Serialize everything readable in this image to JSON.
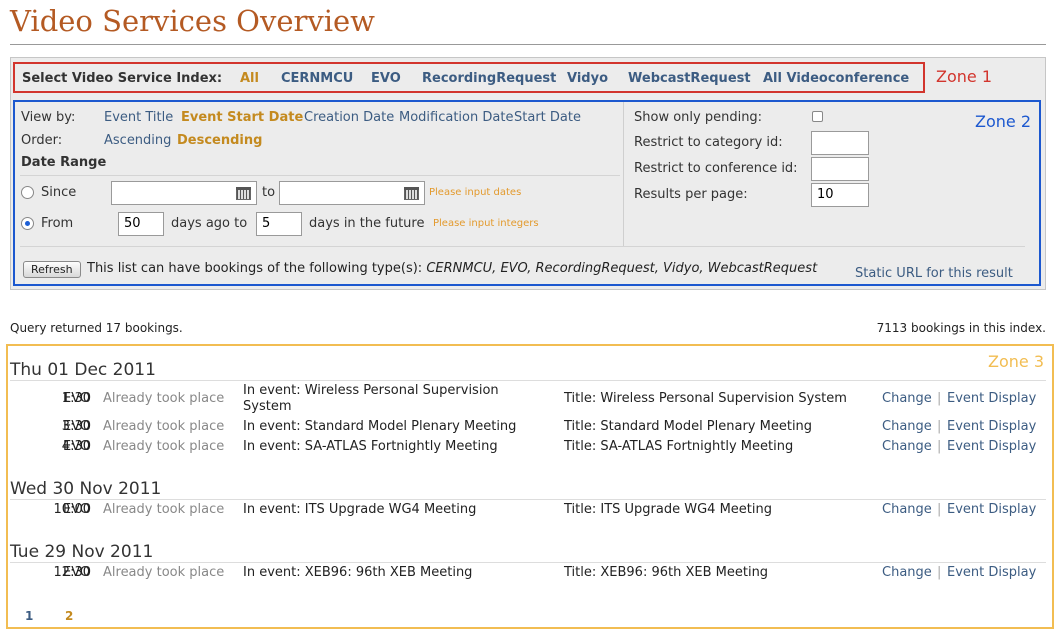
{
  "page_title": "Video Services Overview",
  "zones": {
    "zone1": "Zone 1",
    "zone2": "Zone 2",
    "zone3": "Zone 3"
  },
  "index_bar": {
    "label": "Select Video Service Index:",
    "items": [
      "All",
      "CERNMCU",
      "EVO",
      "RecordingRequest",
      "Vidyo",
      "WebcastRequest",
      "All Videoconference"
    ],
    "active": "All"
  },
  "filters": {
    "view_by_label": "View by:",
    "view_by_options": [
      "Event Title",
      "Event Start Date",
      "Creation Date",
      "Modification Date",
      "Start Date"
    ],
    "view_by_active": "Event Start Date",
    "order_label": "Order:",
    "order_options": [
      "Ascending",
      "Descending"
    ],
    "order_active": "Descending",
    "date_range_label": "Date Range",
    "since_label": "Since",
    "to_label": "to",
    "dates_hint": "Please input dates",
    "from_label": "From",
    "days_ago_value": "50",
    "days_ago_label": "days ago to",
    "days_future_value": "5",
    "days_future_label": "days in the future",
    "integers_hint": "Please input integers",
    "selected_range_mode": "From",
    "show_only_pending_label": "Show only pending:",
    "show_only_pending_checked": false,
    "restrict_category_label": "Restrict to category id:",
    "restrict_category_value": "",
    "restrict_conference_label": "Restrict to conference id:",
    "restrict_conference_value": "",
    "results_per_page_label": "Results per page:",
    "results_per_page_value": "10",
    "refresh_label": "Refresh",
    "types_prefix": "This list can have bookings of the following type(s):",
    "types_list": "CERNMCU, EVO, RecordingRequest, Vidyo, WebcastRequest",
    "static_url_label": "Static URL for this result"
  },
  "summary": {
    "query_text": "Query returned 17 bookings.",
    "index_text": "7113 bookings in this index."
  },
  "results": [
    {
      "day": "Thu 01 Dec 2011",
      "rows": [
        {
          "time": "1:30",
          "type": "EVO",
          "status": "Already took place",
          "event_line1": "In event: Wireless Personal Supervision",
          "event_line2": "System",
          "title": "Title: Wireless Personal Supervision System"
        },
        {
          "time": "3:30",
          "type": "EVO",
          "status": "Already took place",
          "event_line1": "In event: Standard Model Plenary Meeting",
          "event_line2": "",
          "title": "Title: Standard Model Plenary Meeting"
        },
        {
          "time": "4:30",
          "type": "EVO",
          "status": "Already took place",
          "event_line1": "In event: SA-ATLAS Fortnightly Meeting",
          "event_line2": "",
          "title": "Title: SA-ATLAS Fortnightly Meeting"
        }
      ]
    },
    {
      "day": "Wed 30 Nov 2011",
      "rows": [
        {
          "time": "10:00",
          "type": "EVO",
          "status": "Already took place",
          "event_line1": "In event: ITS Upgrade WG4 Meeting",
          "event_line2": "",
          "title": "Title: ITS Upgrade WG4 Meeting"
        }
      ]
    },
    {
      "day": "Tue 29 Nov 2011",
      "rows": [
        {
          "time": "12:30",
          "type": "EVO",
          "status": "Already took place",
          "event_line1": "In event: XEB96: 96th XEB Meeting",
          "event_line2": "",
          "title": "Title: XEB96: 96th XEB Meeting"
        }
      ]
    }
  ],
  "row_actions": {
    "change_label": "Change",
    "separator": "|",
    "display_label": "Event Display"
  },
  "pagination": {
    "pages": [
      "1",
      "2"
    ],
    "current": "2"
  },
  "colors": {
    "title": "#b45a23",
    "link": "#3c5c82",
    "active": "#c48a1f",
    "zone1": "#d2352d",
    "zone2": "#1c58cf",
    "zone3": "#f2bd52",
    "hint": "#e39a2d"
  }
}
